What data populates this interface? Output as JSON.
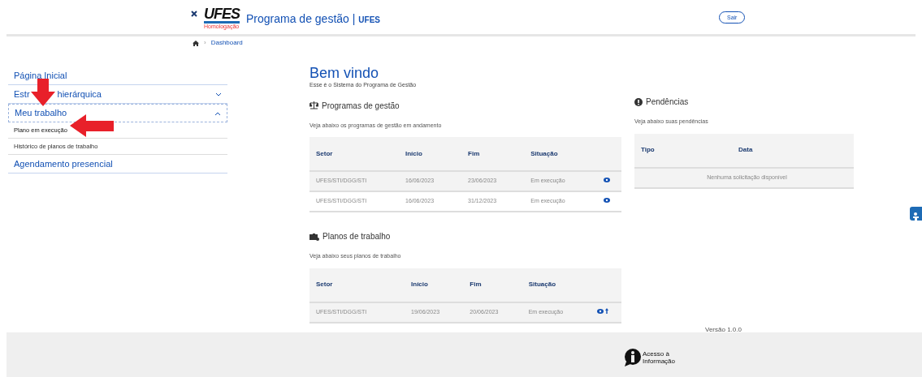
{
  "header": {
    "logo_text": "UFES",
    "logo_caption": "Homologação",
    "title": "Programa de gestão",
    "separator": "|",
    "subtitle": "UFES",
    "logout_button": "Sair"
  },
  "breadcrumb": {
    "separator": "›",
    "items": [
      "Dashboard"
    ]
  },
  "sidebar": {
    "items": [
      {
        "label": "Página Inicial",
        "kind": "link"
      },
      {
        "label_parts": [
          "Estr",
          "hierárquica"
        ],
        "kind": "group",
        "expanded": false
      },
      {
        "label": "Meu trabalho",
        "kind": "group",
        "expanded": true,
        "children": [
          {
            "label": "Plano em execução",
            "selected": true
          },
          {
            "label": "Histórico de planos de trabalho",
            "selected": false
          }
        ]
      },
      {
        "label": "Agendamento presencial",
        "kind": "link"
      }
    ]
  },
  "welcome": {
    "title": "Bem vindo",
    "subtitle": "Esse é o Sistema do Programa de Gestão"
  },
  "programas": {
    "title": "Programas de gestão",
    "description": "Veja abaixo os programas de gestão em andamento",
    "columns": [
      "Setor",
      "Início",
      "Fim",
      "Situação"
    ],
    "rows": [
      {
        "cells": [
          "UFES/STI/DGG/STI",
          "16/06/2023",
          "23/06/2023",
          "Em execução"
        ],
        "actions": [
          {
            "kind": "view"
          }
        ]
      },
      {
        "cells": [
          "UFES/STI/DGG/STI",
          "16/06/2023",
          "31/12/2023",
          "Em execução"
        ],
        "actions": [
          {
            "kind": "view"
          }
        ]
      }
    ]
  },
  "planos": {
    "title": "Planos de trabalho",
    "description": "Veja abaixo seus planos de trabalho",
    "columns": [
      "Setor",
      "Início",
      "Fim",
      "Situação"
    ],
    "rows": [
      {
        "cells": [
          "UFES/STI/DGG/STI",
          "19/06/2023",
          "20/06/2023",
          "Em execução"
        ],
        "actions": [
          {
            "kind": "view"
          },
          {
            "kind": "upload"
          }
        ]
      }
    ]
  },
  "pendencias": {
    "title": "Pendências",
    "description": "Veja abaixo suas pendências",
    "columns": [
      "Tipo",
      "Data"
    ],
    "empty_message": "Nenhuma solicitação disponível"
  },
  "version": "Versão 1.0.0",
  "footer": {
    "access_info": "Acesso à Informação"
  }
}
